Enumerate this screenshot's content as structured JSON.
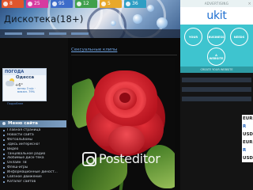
{
  "header": {
    "site_title": "Дискотека(18+)",
    "counters": [
      {
        "label": "8",
        "color": "#e0562c"
      },
      {
        "label": "25",
        "color": "#d63aa0"
      },
      {
        "label": "95",
        "color": "#3d6cc9"
      },
      {
        "label": "12",
        "color": "#40a04c"
      },
      {
        "label": "5",
        "color": "#e8a82a"
      },
      {
        "label": "36",
        "color": "#2e9ec4"
      }
    ]
  },
  "weather": {
    "provider": "ПОГОДА",
    "city": "Одесса",
    "temp": "+6°",
    "details": "ветер 3 м/с · влажн. 79%",
    "link": "Подробнее"
  },
  "sidebar": {
    "menu_title": "Меню сайта",
    "items": [
      "Главная страница",
      "Новости сайта",
      "Фотоальбомы",
      "Здесь интересно!",
      "Видео",
      "Танцевальное радио",
      "Любимые диск-тека",
      "Онлайн ТВ",
      "Флеш-игры",
      "Информационные диност...",
      "Связное движение",
      "Каталог сайтов"
    ]
  },
  "main": {
    "section_title": "Сексуальные клипы",
    "photo_alt": "red rose",
    "watermark": "Posteditor"
  },
  "ad": {
    "top_label": "ADVERTISING",
    "logo": "ukit",
    "bubbles": [
      "YOUR",
      "BUSINESS",
      "NEEDS",
      "A WEBSITE"
    ],
    "bottom_label": "CREATE YOUR WEBSITE",
    "colors": {
      "bg": "#3ec4cf",
      "logo": "#1e6fd0"
    }
  },
  "currency": {
    "labels": [
      "EUR",
      "R",
      "USD",
      "EUR",
      "R",
      "USD"
    ]
  }
}
